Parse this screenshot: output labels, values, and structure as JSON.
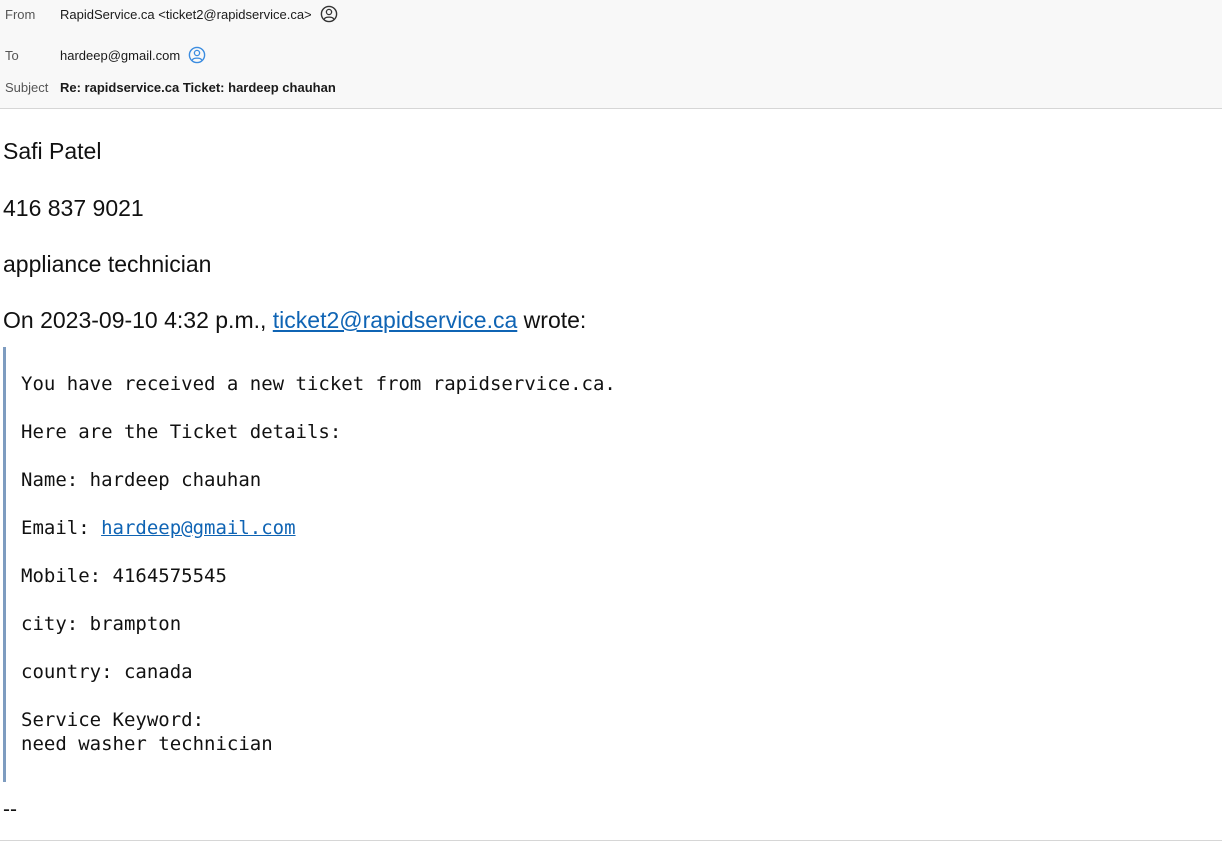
{
  "header": {
    "from_label": "From",
    "from_value": "RapidService.ca <ticket2@rapidservice.ca>",
    "to_label": "To",
    "to_value": "hardeep@gmail.com",
    "subject_label": "Subject",
    "subject_value": "Re: rapidservice.ca Ticket: hardeep chauhan",
    "from_icon": "person-circle-icon",
    "to_icon": "person-circle-icon",
    "accent_color": "#3b8ce0"
  },
  "body": {
    "signature_name": "Safi Patel",
    "signature_phone": "416 837 9021",
    "signature_title": "appliance technician",
    "wrote_prefix": "On 2023-09-10 4:32 p.m., ",
    "wrote_link": "ticket2@rapidservice.ca",
    "wrote_suffix": " wrote:",
    "link_color": "#0f64b4",
    "quote_bar_color": "#7e9cc0",
    "quoted": {
      "line1": "You have received a new ticket from rapidservice.ca.",
      "line2": "Here are the Ticket details:",
      "line3": "Name: hardeep chauhan",
      "email_label": "Email: ",
      "email_link": "hardeep@gmail.com",
      "line5": "Mobile: 4164575545",
      "line6": "city: brampton",
      "line7": "country: canada",
      "line8": "Service Keyword:",
      "line9": "need washer technician"
    },
    "closing_dashes": "--"
  }
}
